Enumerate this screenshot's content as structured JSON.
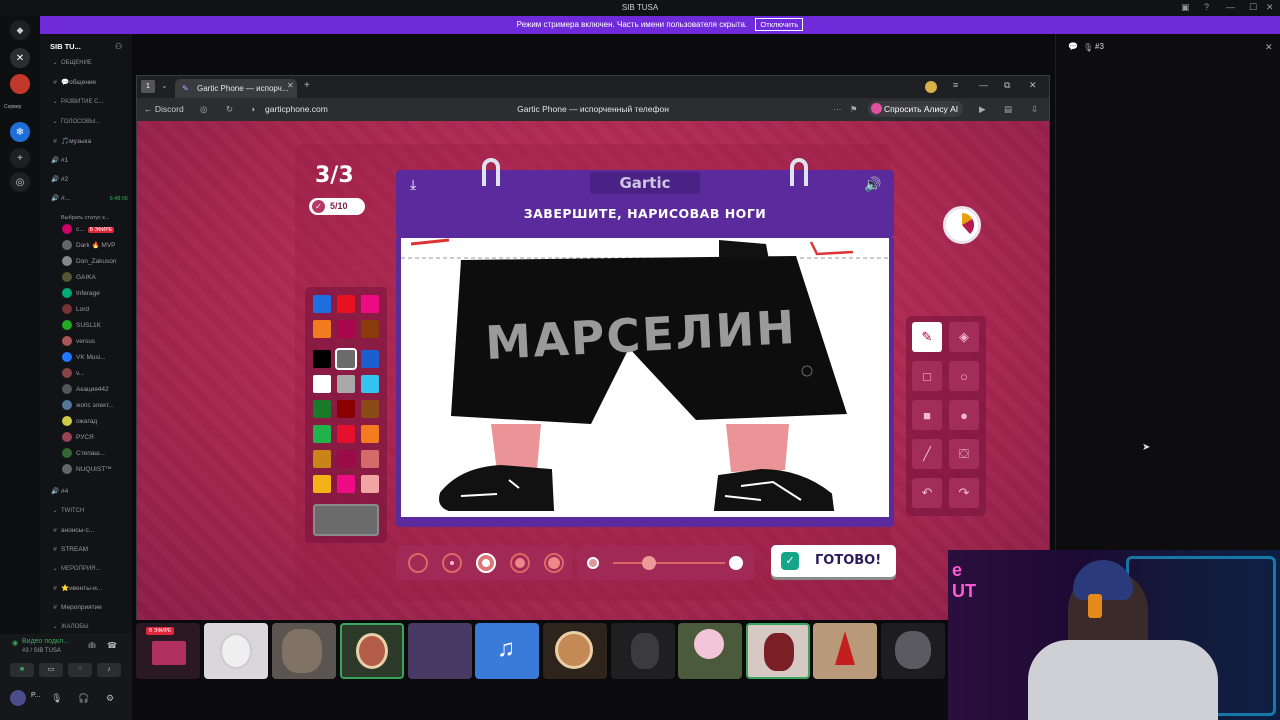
{
  "window": {
    "title": "SIB TUSA"
  },
  "banner": {
    "text": "Режим стримера включен. Часть имени пользователя скрыта.",
    "button": "Отключить"
  },
  "server": {
    "name": "SIB TU...",
    "label": "Сервер"
  },
  "channels": [
    {
      "type": "cat",
      "label": "ОБЩЕНИЕ"
    },
    {
      "type": "text",
      "label": "💬общение"
    },
    {
      "type": "cat",
      "label": "РАЗВИТИЕ С..."
    },
    {
      "type": "cat",
      "label": "ГОЛОСОВЫ..."
    },
    {
      "type": "text",
      "label": "🎵музыка"
    },
    {
      "type": "voice",
      "label": "#1"
    },
    {
      "type": "voice",
      "label": "#2"
    },
    {
      "type": "voice",
      "label": "#...",
      "extra": "6:48:06"
    },
    {
      "type": "sub",
      "label": "Выбрать статус к..."
    }
  ],
  "users": [
    {
      "name": "с...",
      "badge": "В ЭФИРЕ",
      "color": "#c06"
    },
    {
      "name": "Dark 🔥 MVP",
      "color": "#666"
    },
    {
      "name": "Don_Zakuson",
      "color": "#888"
    },
    {
      "name": "GAIKA",
      "color": "#553"
    },
    {
      "name": "Inferage",
      "color": "#0a7"
    },
    {
      "name": "Lord",
      "color": "#733"
    },
    {
      "name": "SUSL1K",
      "color": "#2a2"
    },
    {
      "name": "versus",
      "color": "#a55"
    },
    {
      "name": "VK Musi...",
      "color": "#27f"
    },
    {
      "name": "v...",
      "color": "#844"
    },
    {
      "name": "Акация442",
      "color": "#555"
    },
    {
      "name": "жопс элект...",
      "color": "#579"
    },
    {
      "name": "ожагад",
      "color": "#cc4"
    },
    {
      "name": "РУСЯ",
      "color": "#945"
    },
    {
      "name": "Степаш...",
      "color": "#363"
    },
    {
      "name": "NUQUIST™",
      "color": "#666"
    }
  ],
  "channels2": [
    {
      "type": "voice",
      "label": "#4"
    },
    {
      "type": "cat",
      "label": "TWITCH"
    },
    {
      "type": "text",
      "label": "анонсы-с..."
    },
    {
      "type": "text",
      "label": "STREAM"
    },
    {
      "type": "cat",
      "label": "МЕРОПРИЯ..."
    },
    {
      "type": "text",
      "label": "⭐ивенты-и..."
    },
    {
      "type": "text",
      "label": "Мероприятие"
    },
    {
      "type": "cat",
      "label": "ЖАЛОБЫ"
    }
  ],
  "voice_panel": {
    "status": "Видео подкл...",
    "channel": "#3 / SIB TUSA",
    "user": "P..."
  },
  "browser": {
    "tab_title": "Gartic Phone — испорч...",
    "back_label": "Discord",
    "url": "garticphone.com",
    "page_title": "Gartic Phone — испорченный телефон",
    "ask_ai": "Спросить Алису AI"
  },
  "game": {
    "round": "3/3",
    "done_count": "5/10",
    "logo": "Gartic",
    "prompt": "ЗАВЕРШИТЕ, НАРИСОВАВ НОГИ",
    "drawing_text": "МАРСЕЛИН",
    "done_button": "ГОТОВО!",
    "palette": [
      "#1d6fe0",
      "#e8121f",
      "#ee0b86",
      "#f27b1f",
      "#a8064d",
      "#8a3b0b",
      "#000000",
      "#6b6b6b",
      "#1b5fd0",
      "#ffffff",
      "#a9a9a9",
      "#35c3ef",
      "#1a7a2a",
      "#8a0000",
      "#8a4b16",
      "#22b24b",
      "#e5102e",
      "#f47b20",
      "#c8841a",
      "#9a0b48",
      "#d46a6a",
      "#f4b219",
      "#ee0b86",
      "#f2a3a3"
    ],
    "current_color": "#6b6b6b",
    "tools": [
      "pen-icon",
      "eraser-icon",
      "rect-outline-icon",
      "ellipse-outline-icon",
      "rect-fill-icon",
      "ellipse-fill-icon",
      "line-icon",
      "fill-bucket-icon",
      "undo-icon",
      "redo-icon"
    ]
  },
  "right_panel": {
    "title": "#3"
  },
  "stream_strip": {
    "live_badge": "В ЭФИРЕ"
  }
}
